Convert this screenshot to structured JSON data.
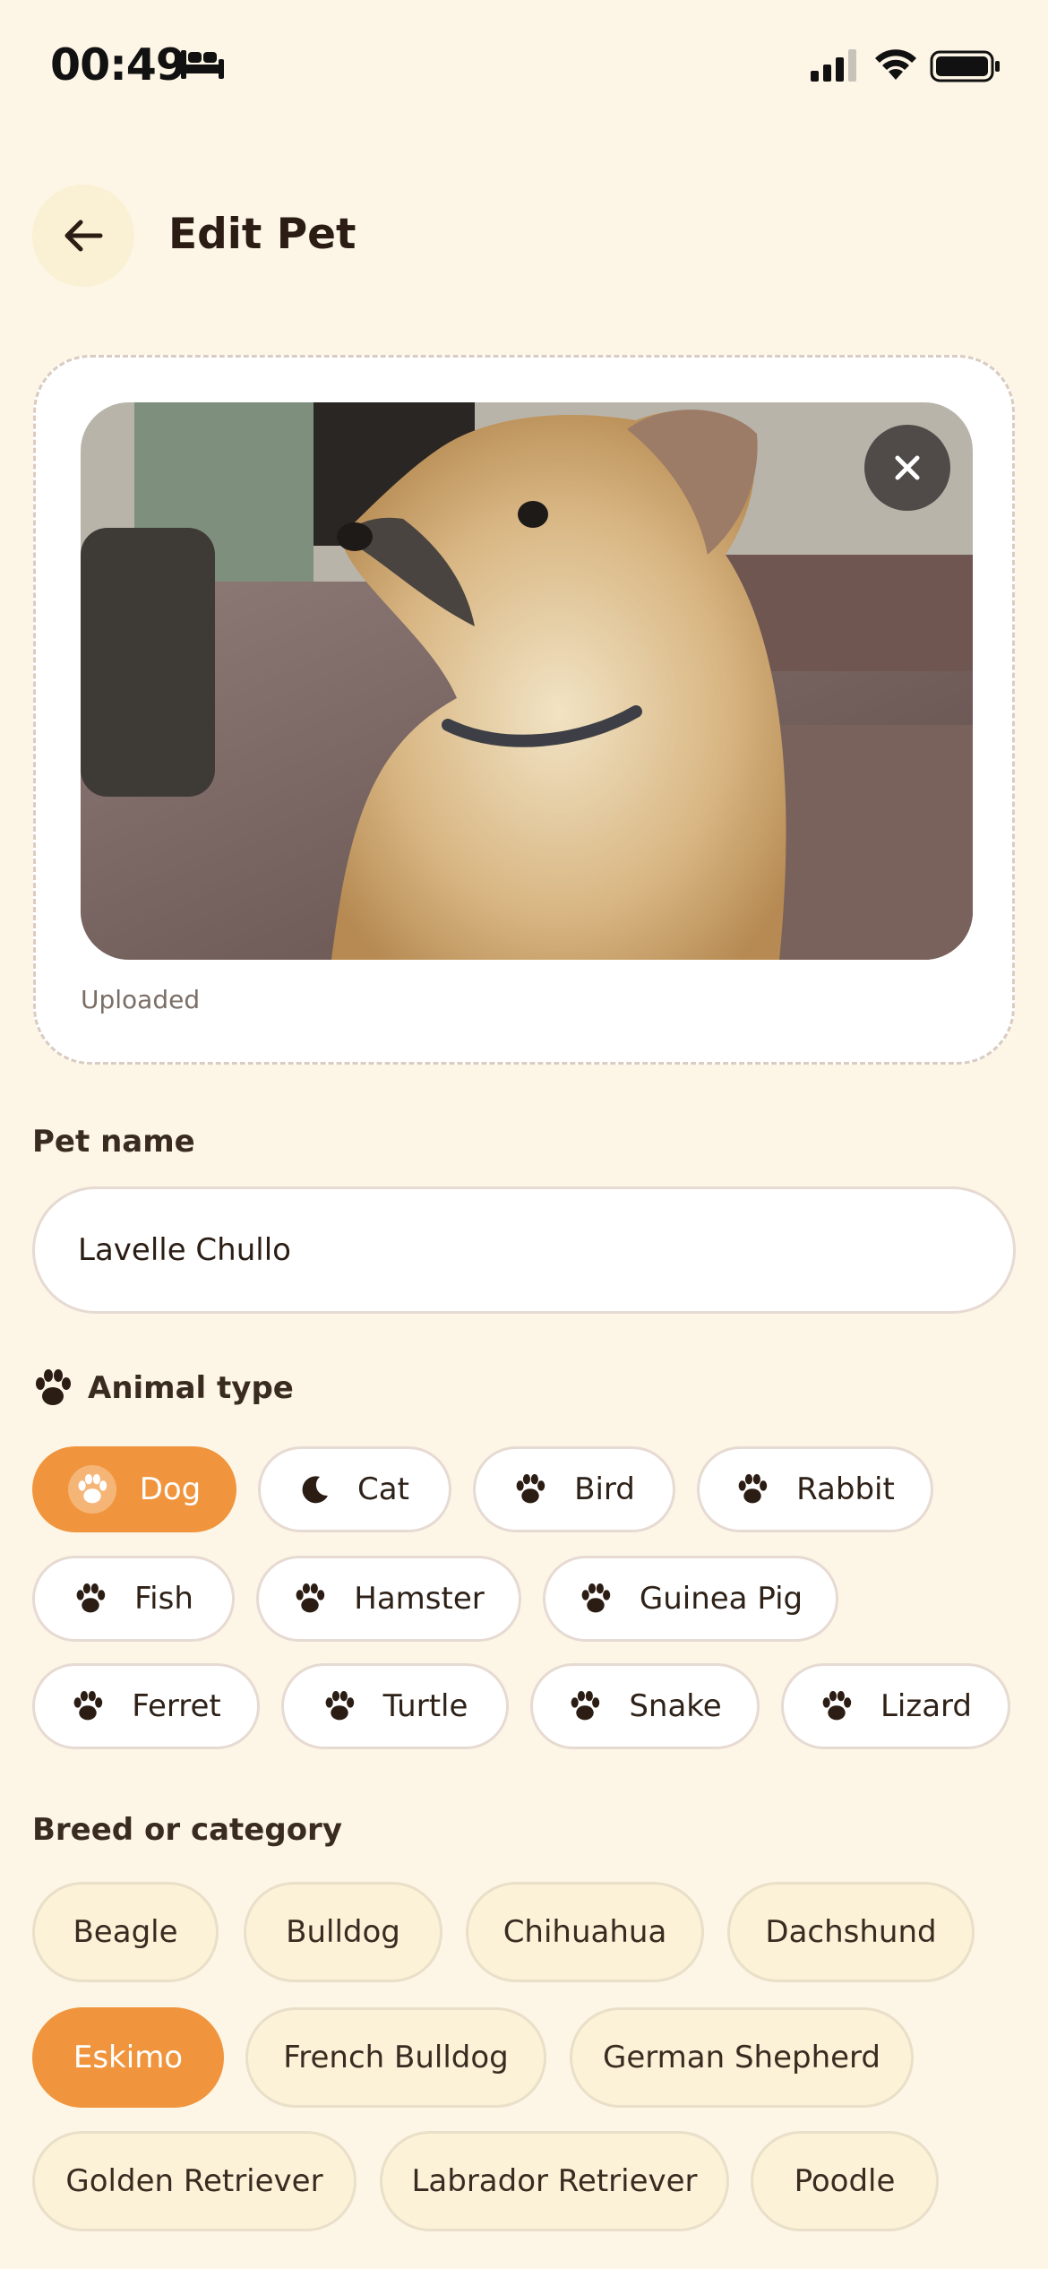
{
  "status_bar": {
    "time": "00:49",
    "icons": [
      "bed-icon",
      "cellular-signal-icon",
      "wifi-icon",
      "battery-icon"
    ]
  },
  "header": {
    "back_icon": "arrow-left-icon",
    "title": "Edit Pet"
  },
  "photo": {
    "status": "Uploaded",
    "remove_icon": "close-icon"
  },
  "pet_name": {
    "label": "Pet name",
    "value": "Lavelle Chullo"
  },
  "animal_type": {
    "label": "Animal type",
    "icon": "paw-icon",
    "selected": "Dog",
    "options": [
      {
        "label": "Dog",
        "icon": "paw-icon"
      },
      {
        "label": "Cat",
        "icon": "moon-icon"
      },
      {
        "label": "Bird",
        "icon": "paw-icon"
      },
      {
        "label": "Rabbit",
        "icon": "paw-icon"
      },
      {
        "label": "Fish",
        "icon": "paw-icon"
      },
      {
        "label": "Hamster",
        "icon": "paw-icon"
      },
      {
        "label": "Guinea Pig",
        "icon": "paw-icon"
      },
      {
        "label": "Ferret",
        "icon": "paw-icon"
      },
      {
        "label": "Turtle",
        "icon": "paw-icon"
      },
      {
        "label": "Snake",
        "icon": "paw-icon"
      },
      {
        "label": "Lizard",
        "icon": "paw-icon"
      }
    ]
  },
  "breed": {
    "label": "Breed or category",
    "selected": "Eskimo",
    "options": [
      "Beagle",
      "Bulldog",
      "Chihuahua",
      "Dachshund",
      "Eskimo",
      "French Bulldog",
      "German Shepherd",
      "Golden Retriever",
      "Labrador Retriever",
      "Poodle"
    ]
  },
  "colors": {
    "background": "#FDF6E6",
    "accent": "#F0953D",
    "chip_border": "#E6DAD2",
    "breed_chip_bg": "#FBF2D8",
    "text": "#2E2118"
  }
}
